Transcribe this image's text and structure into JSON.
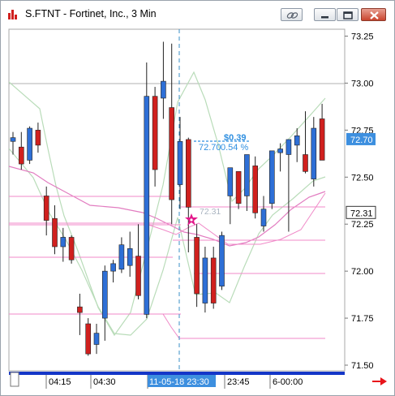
{
  "window": {
    "title": "S.FTNT - Fortinet, Inc., 3 Min"
  },
  "titlebar_buttons": [
    "link",
    "minimize",
    "restore",
    "close"
  ],
  "chart_data": {
    "type": "candlestick",
    "symbol": "S.FTNT",
    "ylim": [
      71.5,
      73.25
    ],
    "y_ticks": [
      "73.25",
      "73.00",
      "72.75",
      "72.50",
      "72.25",
      "72.00",
      "71.75",
      "71.50"
    ],
    "x_ticks": [
      "04:15",
      "04:30",
      "11-05-18 23:30",
      "23:45",
      "6-00:00"
    ],
    "highlighted_x_tick": "11-05-18 23:30",
    "last_price_label": "72.70",
    "cursor_price_label": "72.31",
    "annotation": {
      "change": "$0.39",
      "price": "72.70",
      "percent": "0.54 %"
    },
    "marker_price_label": "72.31",
    "colors": {
      "up": "#2e6fd6",
      "down": "#d0201e",
      "last_price_bg": "#3d8fdf",
      "band": "#b9dcb9",
      "trend": "#f08ac8",
      "marker": "#e3178a",
      "annotation": "#2f8fe0"
    },
    "candles": [
      {
        "o": 72.69,
        "h": 72.74,
        "l": 72.62,
        "c": 72.71
      },
      {
        "o": 72.66,
        "h": 72.74,
        "l": 72.54,
        "c": 72.57
      },
      {
        "o": 72.59,
        "h": 72.77,
        "l": 72.57,
        "c": 72.76
      },
      {
        "o": 72.75,
        "h": 72.79,
        "l": 72.63,
        "c": 72.67
      },
      {
        "o": 72.4,
        "h": 72.45,
        "l": 72.19,
        "c": 72.27
      },
      {
        "o": 72.28,
        "h": 72.35,
        "l": 72.09,
        "c": 72.13
      },
      {
        "o": 72.13,
        "h": 72.23,
        "l": 72.05,
        "c": 72.18
      },
      {
        "o": 72.18,
        "h": 72.19,
        "l": 72.04,
        "c": 72.06
      },
      {
        "o": 71.81,
        "h": 71.88,
        "l": 71.66,
        "c": 71.78
      },
      {
        "o": 71.72,
        "h": 71.75,
        "l": 71.55,
        "c": 71.56
      },
      {
        "o": 71.61,
        "h": 71.72,
        "l": 71.56,
        "c": 71.67
      },
      {
        "o": 71.75,
        "h": 72.03,
        "l": 71.63,
        "c": 72.0
      },
      {
        "o": 72.0,
        "h": 72.06,
        "l": 71.94,
        "c": 72.04
      },
      {
        "o": 72.01,
        "h": 72.18,
        "l": 71.99,
        "c": 72.14
      },
      {
        "o": 72.03,
        "h": 72.21,
        "l": 71.97,
        "c": 72.12
      },
      {
        "o": 72.08,
        "h": 72.25,
        "l": 71.85,
        "c": 71.87
      },
      {
        "o": 71.77,
        "h": 73.11,
        "l": 71.75,
        "c": 72.93
      },
      {
        "o": 72.93,
        "h": 72.98,
        "l": 72.45,
        "c": 72.54
      },
      {
        "o": 72.92,
        "h": 73.22,
        "l": 72.81,
        "c": 73.01
      },
      {
        "o": 72.87,
        "h": 73.21,
        "l": 72.25,
        "c": 72.38
      },
      {
        "o": 72.46,
        "h": 72.82,
        "l": 72.33,
        "c": 72.69
      },
      {
        "o": 72.7,
        "h": 72.71,
        "l": 72.1,
        "c": 72.34
      },
      {
        "o": 72.18,
        "h": 72.25,
        "l": 71.81,
        "c": 71.88
      },
      {
        "o": 71.83,
        "h": 72.13,
        "l": 71.78,
        "c": 72.07
      },
      {
        "o": 72.07,
        "h": 72.13,
        "l": 71.8,
        "c": 71.83
      },
      {
        "o": 71.92,
        "h": 72.21,
        "l": 71.9,
        "c": 72.19
      },
      {
        "o": 72.4,
        "h": 72.51,
        "l": 72.25,
        "c": 72.55
      },
      {
        "o": 72.53,
        "h": 72.52,
        "l": 72.33,
        "c": 72.36
      },
      {
        "o": 72.4,
        "h": 72.56,
        "l": 72.32,
        "c": 72.62
      },
      {
        "o": 72.56,
        "h": 72.61,
        "l": 72.28,
        "c": 72.31
      },
      {
        "o": 72.24,
        "h": 72.4,
        "l": 72.21,
        "c": 72.33
      },
      {
        "o": 72.36,
        "h": 72.56,
        "l": 72.33,
        "c": 72.64
      },
      {
        "o": 72.63,
        "h": 72.68,
        "l": 72.53,
        "c": 72.65
      },
      {
        "o": 72.62,
        "h": 72.63,
        "l": 72.21,
        "c": 72.7
      },
      {
        "o": 72.67,
        "h": 72.76,
        "l": 72.58,
        "c": 72.72
      },
      {
        "o": 72.62,
        "h": 72.85,
        "l": 72.52,
        "c": 72.53
      },
      {
        "o": 72.49,
        "h": 72.82,
        "l": 72.45,
        "c": 72.76
      },
      {
        "o": 72.81,
        "h": 72.89,
        "l": 72.6,
        "c": 72.59
      }
    ]
  }
}
